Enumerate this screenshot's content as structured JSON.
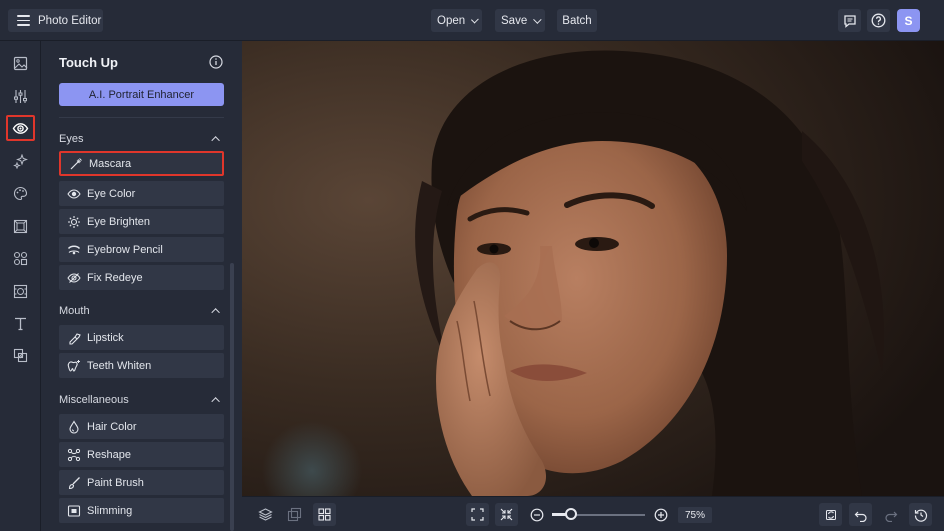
{
  "app": {
    "title": "Photo Editor"
  },
  "menu": {
    "open": "Open",
    "save": "Save",
    "batch": "Batch"
  },
  "user": {
    "initial": "S",
    "avatar_color": "#8c95f2"
  },
  "rail": [
    "image-icon",
    "sliders-icon",
    "eye-icon",
    "sparkle-icon",
    "palette-icon",
    "frame-icon",
    "shapes-icon",
    "texture-icon",
    "text-icon",
    "overlay-icon"
  ],
  "panel": {
    "title": "Touch Up",
    "ai_button": "A.I. Portrait Enhancer",
    "sections": {
      "eyes": "Eyes",
      "mouth": "Mouth",
      "misc": "Miscellaneous"
    },
    "tools": {
      "mascara": "Mascara",
      "eye_color": "Eye Color",
      "eye_brighten": "Eye Brighten",
      "eyebrow_pencil": "Eyebrow Pencil",
      "fix_redeye": "Fix Redeye",
      "lipstick": "Lipstick",
      "teeth_whiten": "Teeth Whiten",
      "hair_color": "Hair Color",
      "reshape": "Reshape",
      "paint_brush": "Paint Brush",
      "slimming": "Slimming"
    }
  },
  "zoom": {
    "value_label": "75%",
    "level": 0.2
  },
  "colors": {
    "accent": "#8c95f2",
    "highlight": "#e0362b",
    "background": "#1f2430",
    "panel": "#262b38"
  }
}
